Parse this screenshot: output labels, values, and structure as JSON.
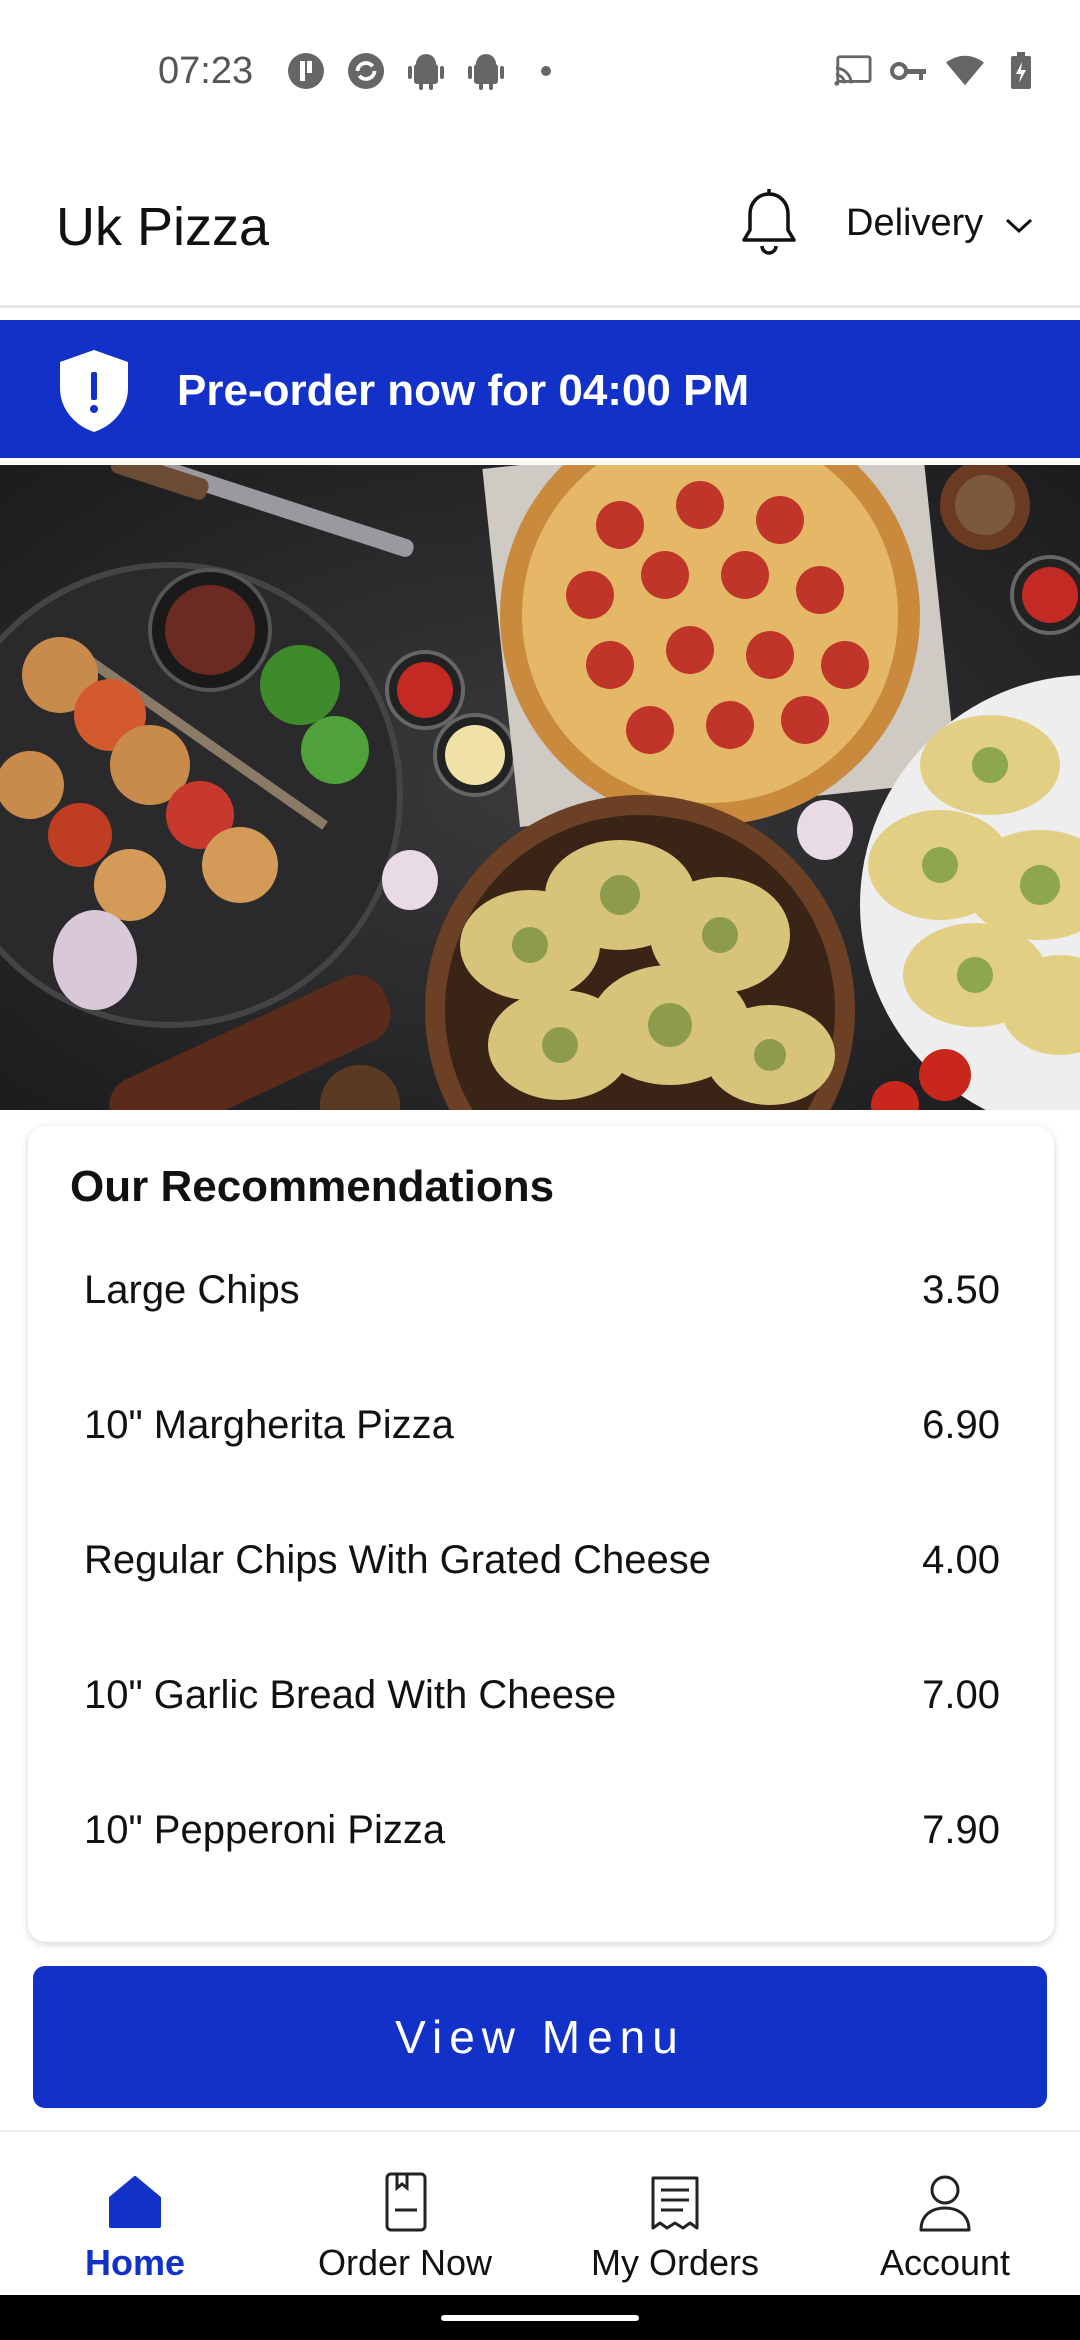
{
  "status_bar": {
    "time": "07:23"
  },
  "header": {
    "title": "Uk Pizza",
    "delivery_label": "Delivery"
  },
  "banner": {
    "text": "Pre-order now for 04:00 PM"
  },
  "recommendations": {
    "title": "Our Recommendations",
    "items": [
      {
        "name": "Large Chips",
        "price": "3.50"
      },
      {
        "name": "10\" Margherita Pizza",
        "price": "6.90"
      },
      {
        "name": "Regular Chips With Grated Cheese",
        "price": "4.00"
      },
      {
        "name": "10\" Garlic Bread With Cheese",
        "price": "7.00"
      },
      {
        "name": "10\" Pepperoni Pizza",
        "price": "7.90"
      }
    ]
  },
  "view_menu_label": "View Menu",
  "bottom_nav": {
    "items": [
      {
        "label": "Home",
        "icon": "home-icon",
        "active": true
      },
      {
        "label": "Order Now",
        "icon": "order-book-icon",
        "active": false
      },
      {
        "label": "My Orders",
        "icon": "receipt-icon",
        "active": false
      },
      {
        "label": "Account",
        "icon": "person-icon",
        "active": false
      }
    ]
  },
  "colors": {
    "brand_blue": "#1231c9",
    "text": "#111111"
  }
}
